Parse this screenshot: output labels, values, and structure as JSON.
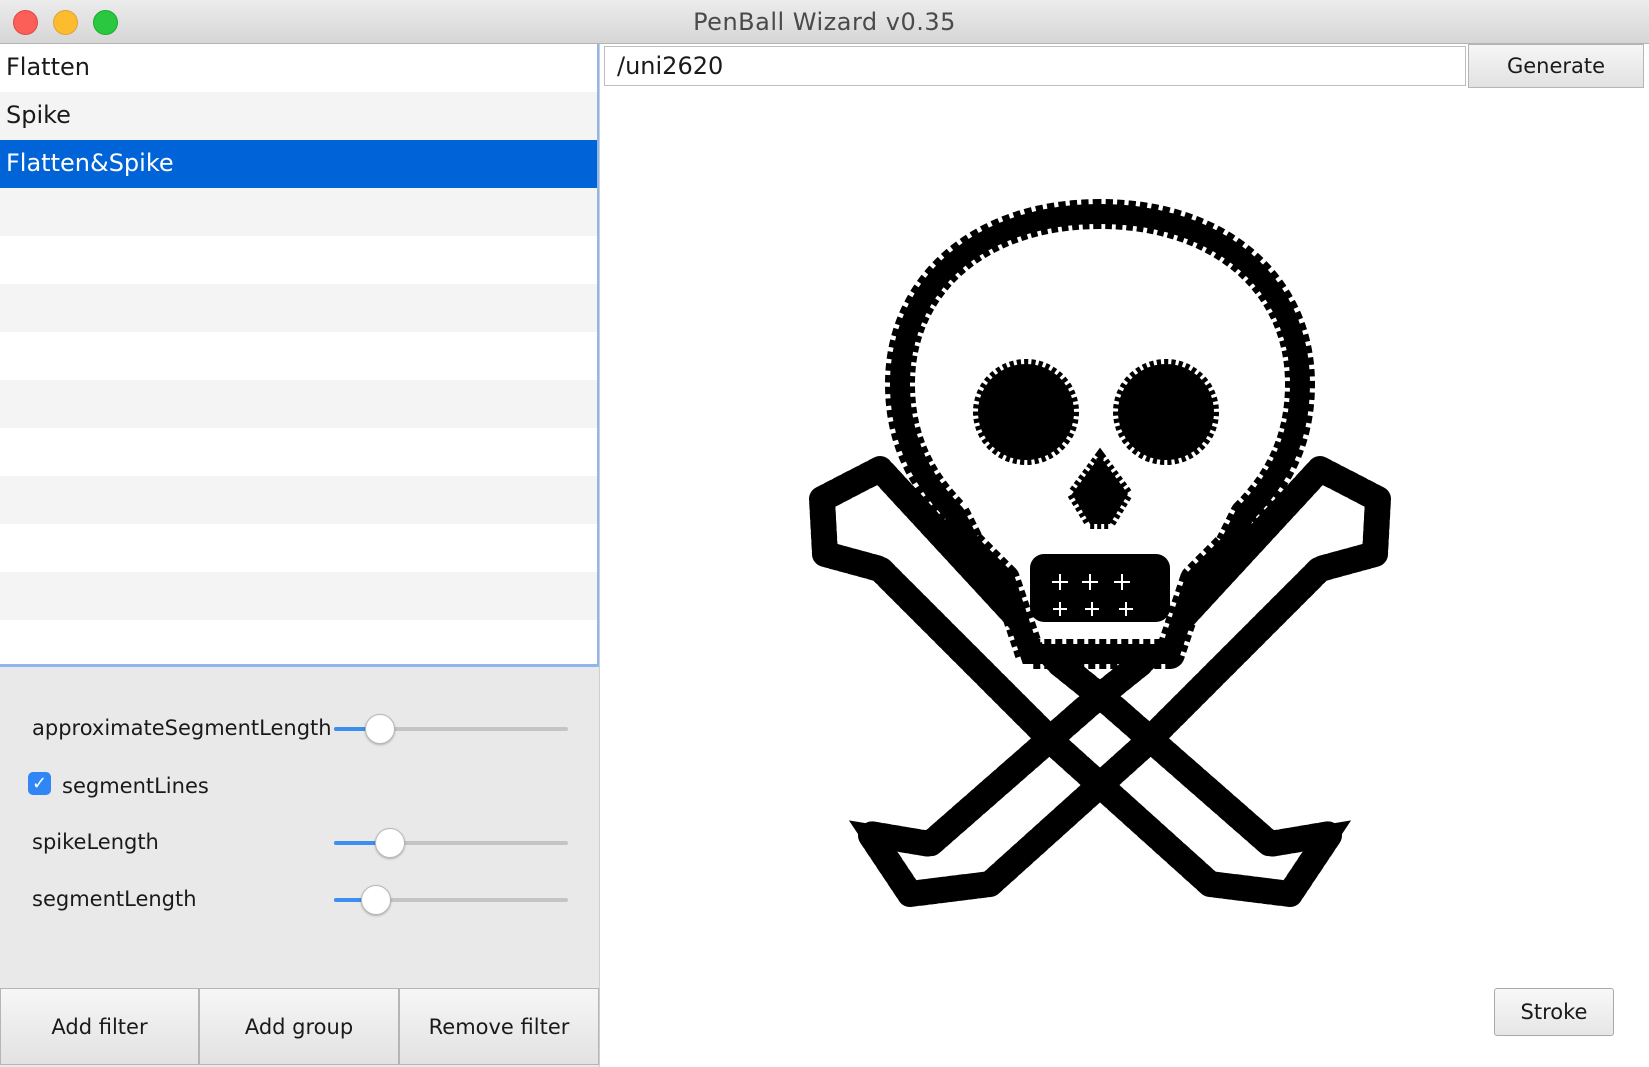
{
  "window": {
    "title": "PenBall Wizard v0.35"
  },
  "filters": [
    {
      "label": "Flatten",
      "selected": false
    },
    {
      "label": "Spike",
      "selected": false
    },
    {
      "label": "Flatten&Spike",
      "selected": true
    }
  ],
  "params": {
    "approximateSegmentLength": {
      "label": "approximateSegmentLength",
      "value": 0.15
    },
    "segmentLines": {
      "label": "segmentLines",
      "checked": true
    },
    "spikeLength": {
      "label": "spikeLength",
      "value": 0.2
    },
    "segmentLength": {
      "label": "segmentLength",
      "value": 0.13
    }
  },
  "buttons": {
    "add_filter": "Add filter",
    "add_group": "Add group",
    "remove_filter": "Remove filter",
    "generate": "Generate",
    "stroke": "Stroke"
  },
  "glyph_input": {
    "value": "/uni2620"
  },
  "icons": {
    "check": "checkmark-icon",
    "preview": "skull-and-crossbones-glyph"
  }
}
